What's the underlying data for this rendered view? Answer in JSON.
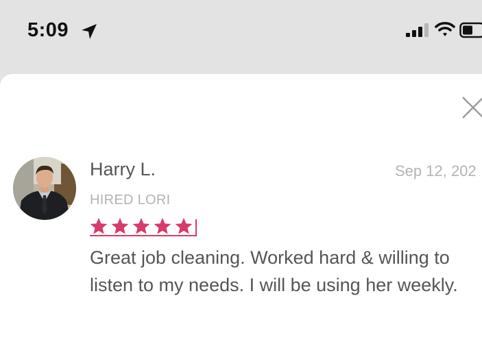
{
  "status_bar": {
    "time": "5:09",
    "icons": [
      "location-arrow-icon",
      "cellular-signal-icon",
      "wifi-icon",
      "battery-icon"
    ],
    "signal_bars_filled": 3,
    "signal_bars_total": 4
  },
  "review": {
    "reviewer_name": "Harry L.",
    "hired_label": "HIRED LORI",
    "date": "Sep 12, 202",
    "rating": 5,
    "rating_max": 5,
    "text": "Great job cleaning. Worked hard & willing to listen to my needs. I will be using her weekly."
  },
  "colors": {
    "star": "#d83a6a",
    "name_text": "#555555",
    "muted_text": "#b3b3b3",
    "status_bg": "#e3e3e3",
    "sheet_bg": "#ffffff"
  }
}
